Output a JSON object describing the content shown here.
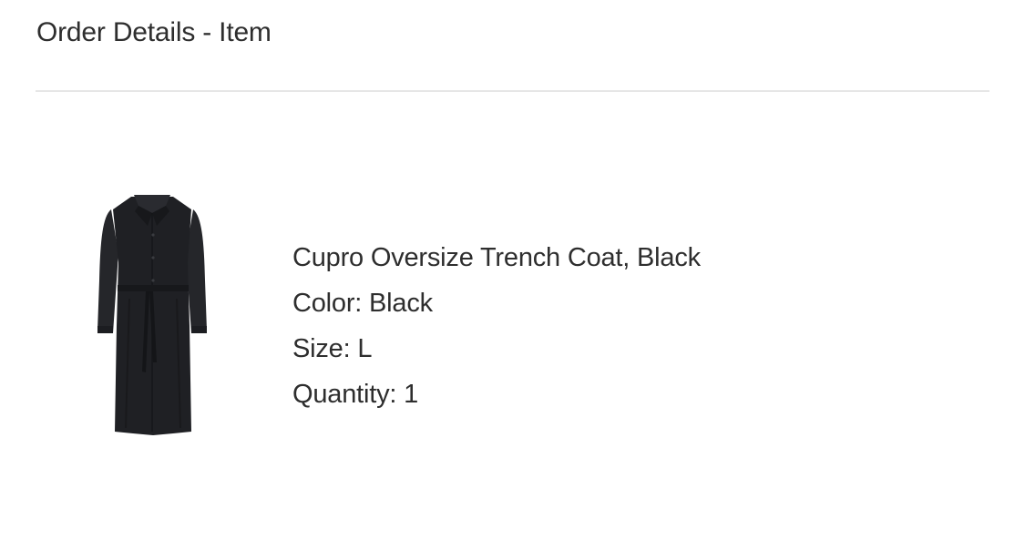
{
  "header": {
    "title": "Order Details - Item"
  },
  "item": {
    "image_icon": "black-trench-coat-image",
    "name": "Cupro Oversize Trench Coat, Black",
    "color": "Color: Black",
    "size": "Size: L",
    "quantity": "Quantity: 1"
  },
  "colors": {
    "text": "#2e2e2e",
    "divider": "#e6e6e6",
    "coat": "#1f2024"
  }
}
